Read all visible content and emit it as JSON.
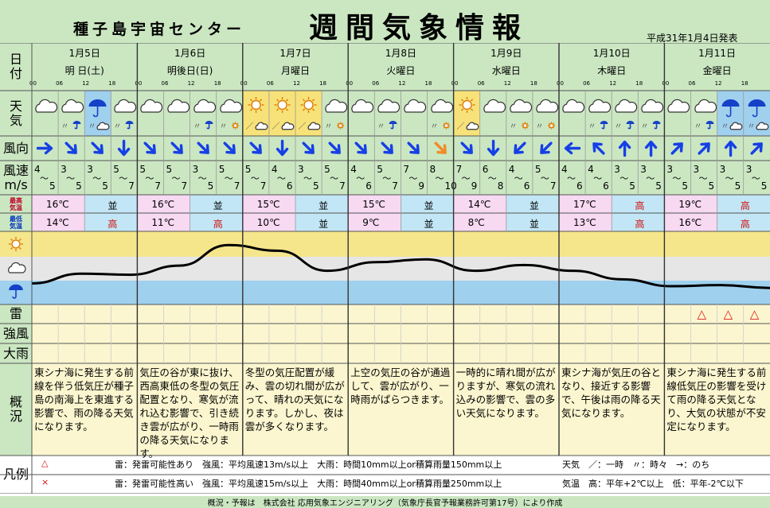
{
  "header": {
    "center": "種子島宇宙センター",
    "title": "週間気象情報",
    "issued": "平成31年1月4日発表"
  },
  "labels": {
    "date": [
      "日",
      "付"
    ],
    "weather": [
      "天",
      "気"
    ],
    "wind_dir": "風向",
    "wind_speed": [
      "風速",
      "m/s"
    ],
    "max_temp": [
      "最高",
      "気温"
    ],
    "min_temp": [
      "最低",
      "気温"
    ],
    "thunder": "雷",
    "strong_wind": "強風",
    "heavy_rain": "大雨",
    "summary": [
      "概",
      "況"
    ],
    "legend": "凡例"
  },
  "hour_ticks": [
    "00",
    "06",
    "12",
    "18"
  ],
  "days": [
    {
      "date": "1月5日",
      "weekday": "明 日(土)",
      "weather": [
        "cloudy",
        "cloudy-rain",
        "rain",
        "cloudy-rain"
      ],
      "weather_blue": [
        false,
        false,
        true,
        false
      ],
      "wind_dir": [
        "E",
        "SE",
        "SE",
        "S"
      ],
      "wind": [
        [
          "4",
          "5"
        ],
        [
          "3",
          "5"
        ],
        [
          "3",
          "5"
        ],
        [
          "5",
          "7"
        ]
      ],
      "max_temp": "16℃",
      "max_level": "並",
      "min_temp": "14℃",
      "min_level": "高",
      "thunder": [
        false,
        false,
        false,
        false
      ],
      "summary": "東シナ海に発生する前線を伴う低気圧が種子島の南海上を東進する影響で、雨の降る天気になります。"
    },
    {
      "date": "1月6日",
      "weekday": "明後日(日)",
      "weather": [
        "cloudy",
        "cloudy",
        "cloudy-rain",
        "cloudy-sun"
      ],
      "weather_blue": [
        false,
        false,
        false,
        false
      ],
      "wind_dir": [
        "SE",
        "SE",
        "SE",
        "SE"
      ],
      "wind": [
        [
          "5",
          "7"
        ],
        [
          "5",
          "7"
        ],
        [
          "3",
          "5"
        ],
        [
          "5",
          "7"
        ]
      ],
      "max_temp": "16℃",
      "max_level": "並",
      "min_temp": "11℃",
      "min_level": "高",
      "thunder": [
        false,
        false,
        false,
        false
      ],
      "summary": "気圧の谷が東に抜け、西高東低の冬型の気圧配置となり、寒気が流れ込む影響で、引き続き雲が広がり、一時雨の降る天気になります。"
    },
    {
      "date": "1月7日",
      "weekday": "月曜日",
      "weather": [
        "sun-cloud",
        "sun-cloud",
        "sun-cloud",
        "cloudy-sun"
      ],
      "weather_blue": [
        false,
        false,
        false,
        false
      ],
      "wind_dir": [
        "SE",
        "S",
        "SE",
        "SE"
      ],
      "wind": [
        [
          "5",
          "7"
        ],
        [
          "4",
          "6"
        ],
        [
          "3",
          "5"
        ],
        [
          "5",
          "7"
        ]
      ],
      "max_temp": "15℃",
      "max_level": "並",
      "min_temp": "10℃",
      "min_level": "並",
      "thunder": [
        false,
        false,
        false,
        false
      ],
      "summary": "冬型の気圧配置が緩み、雲の切れ間が広がって、晴れの天気になります。しかし、夜は雲が多くなります。"
    },
    {
      "date": "1月8日",
      "weekday": "火曜日",
      "weather": [
        "cloudy",
        "cloudy-rain",
        "cloudy",
        "cloudy-sun"
      ],
      "weather_blue": [
        false,
        false,
        false,
        false
      ],
      "wind_dir": [
        "SE",
        "SE",
        "SE",
        "SE"
      ],
      "wind": [
        [
          "4",
          "6"
        ],
        [
          "5",
          "7"
        ],
        [
          "7",
          "9"
        ],
        [
          "8",
          "10"
        ]
      ],
      "max_temp": "15℃",
      "max_level": "並",
      "min_temp": "9℃",
      "min_level": "並",
      "thunder": [
        false,
        false,
        false,
        false
      ],
      "summary": "上空の気圧の谷が通過して、雲が広がり、一時雨がぱらつきます。"
    },
    {
      "date": "1月9日",
      "weekday": "水曜日",
      "weather": [
        "sun-cloud",
        "cloudy",
        "cloudy-sun",
        "cloudy-sun"
      ],
      "weather_blue": [
        false,
        false,
        false,
        false
      ],
      "wind_dir": [
        "SE",
        "S",
        "SW",
        "SW"
      ],
      "wind": [
        [
          "7",
          "9"
        ],
        [
          "6",
          "8"
        ],
        [
          "4",
          "6"
        ],
        [
          "5",
          "7"
        ]
      ],
      "max_temp": "14℃",
      "max_level": "並",
      "min_temp": "8℃",
      "min_level": "並",
      "thunder": [
        false,
        false,
        false,
        false
      ],
      "summary": "一時的に晴れ間が広がりますが、寒気の流れ込みの影響で、雲の多い天気になります。"
    },
    {
      "date": "1月10日",
      "weekday": "木曜日",
      "weather": [
        "cloudy",
        "cloudy-rain",
        "cloudy-rain",
        "cloudy-rain"
      ],
      "weather_blue": [
        false,
        false,
        false,
        false
      ],
      "wind_dir": [
        "W",
        "NW",
        "N",
        "N"
      ],
      "wind": [
        [
          "4",
          "6"
        ],
        [
          "4",
          "6"
        ],
        [
          "3",
          "5"
        ],
        [
          "3",
          "5"
        ]
      ],
      "max_temp": "17℃",
      "max_level": "高",
      "min_temp": "13℃",
      "min_level": "高",
      "thunder": [
        false,
        false,
        false,
        false
      ],
      "summary": "東シナ海が気圧の谷となり、接近する影響で、午後は雨の降る天気になります。"
    },
    {
      "date": "1月11日",
      "weekday": "金曜日",
      "weather": [
        "cloudy",
        "cloudy-rain",
        "rain",
        "rain"
      ],
      "weather_blue": [
        false,
        false,
        true,
        true
      ],
      "wind_dir": [
        "NE",
        "NE",
        "N",
        "NE"
      ],
      "wind": [
        [
          "3",
          "5"
        ],
        [
          "3",
          "5"
        ],
        [
          "3",
          "5"
        ],
        [
          "3",
          "5"
        ]
      ],
      "max_temp": "19℃",
      "max_level": "高",
      "min_temp": "16℃",
      "min_level": "高",
      "thunder": [
        false,
        true,
        true,
        true
      ],
      "summary": "東シナ海に発生する前線低気圧の影響を受けて雨の降る天気となり、大気の状態が不安定になります。"
    }
  ],
  "legend": {
    "sym1": "△",
    "sym2": "×",
    "row1": "雷：発雷可能性あり　強風：平均風速13m/s以上　大雨：時間10mm以上or積算雨量150mm以上",
    "row2": "雷：発雷可能性高い　強風：平均風速15m/s以上　大雨：時間40mm以上or積算雨量250mm以上",
    "weather_note": "天気　／：一時　〃：時々　→：のち",
    "temp_note": "気温　高：平年+2℃以上　低：平年-2℃以下",
    "credit": "概況・予報は　株式会社 応用気象エンジニアリング（気象庁長官予報業務許可第17号）により作成"
  },
  "colors": {
    "background": "#cbe7c2",
    "temp_row": "#f7d9f2",
    "sun_band": "#f5e68c",
    "cloud_band": "#e6e6e6",
    "rain_band": "#9fd0ee",
    "sun_cell": "#f7e27a",
    "rain_cell": "#9fd0ee",
    "arrow": "#1640e6",
    "arrow_alt": "#f08c2a",
    "thunder": "#e01818"
  },
  "trend_curve": [
    0.77,
    0.6,
    0.62,
    0.46,
    0.1,
    0.2,
    0.55,
    0.4,
    0.35,
    0.55,
    0.45,
    0.55,
    0.7,
    0.82,
    0.8,
    0.85
  ]
}
